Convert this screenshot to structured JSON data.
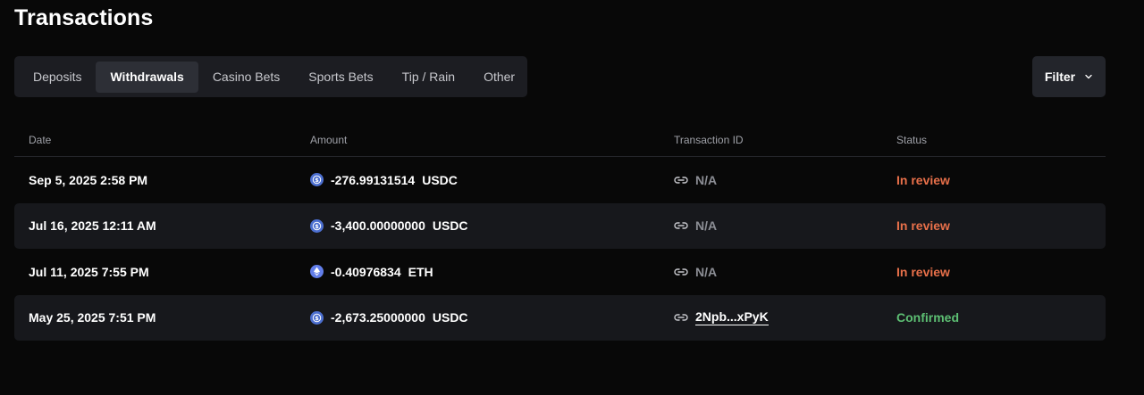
{
  "page": {
    "title": "Transactions"
  },
  "tabs": [
    {
      "label": "Deposits",
      "active": false
    },
    {
      "label": "Withdrawals",
      "active": true
    },
    {
      "label": "Casino Bets",
      "active": false
    },
    {
      "label": "Sports Bets",
      "active": false
    },
    {
      "label": "Tip / Rain",
      "active": false
    },
    {
      "label": "Other",
      "active": false
    }
  ],
  "filter": {
    "label": "Filter",
    "icon": "chevron-down-icon"
  },
  "table": {
    "headers": {
      "date": "Date",
      "amount": "Amount",
      "transaction_id": "Transaction ID",
      "status": "Status"
    },
    "rows": [
      {
        "date": "Sep 5, 2025 2:58 PM",
        "coin_icon": "usdc-icon",
        "amount": "-276.99131514",
        "currency": "USDC",
        "tx_icon": "link-icon",
        "transaction_id": "N/A",
        "status": "In review"
      },
      {
        "date": "Jul 16, 2025 12:11 AM",
        "coin_icon": "usdc-icon",
        "amount": "-3,400.00000000",
        "currency": "USDC",
        "tx_icon": "link-icon",
        "transaction_id": "N/A",
        "status": "In review"
      },
      {
        "date": "Jul 11, 2025 7:55 PM",
        "coin_icon": "eth-icon",
        "amount": "-0.40976834",
        "currency": "ETH",
        "tx_icon": "link-icon",
        "transaction_id": "N/A",
        "status": "In review"
      },
      {
        "date": "May 25, 2025 7:51 PM",
        "coin_icon": "usdc-icon",
        "amount": "-2,673.25000000",
        "currency": "USDC",
        "tx_icon": "link-icon",
        "transaction_id": "2Npb...xPyK",
        "status": "Confirmed"
      }
    ]
  },
  "colors": {
    "background": "#080808",
    "status_in_review": "#e8704a",
    "status_confirmed": "#5dbf73",
    "usdc": "#4c6fd0",
    "eth": "#627eea"
  }
}
